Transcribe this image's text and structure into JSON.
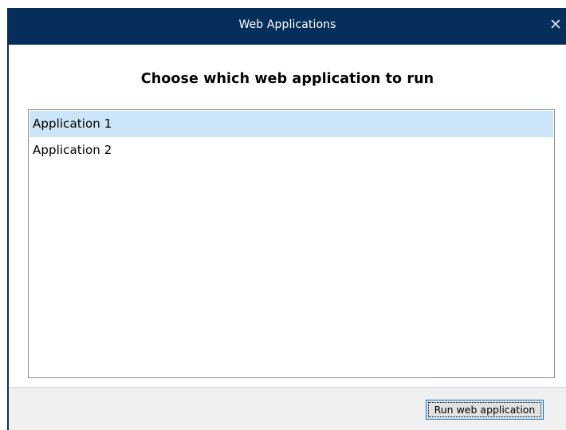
{
  "window": {
    "title": "Web Applications",
    "close_icon": "close-icon",
    "close_glyph": "✕"
  },
  "dialog": {
    "heading": "Choose which web application to run"
  },
  "list": {
    "items": [
      {
        "label": "Application 1",
        "selected": true
      },
      {
        "label": "Application 2",
        "selected": false
      }
    ]
  },
  "footer": {
    "run_label": "Run web application"
  },
  "colors": {
    "titlebar": "#062e5b",
    "selection": "#cce4f7",
    "footer": "#f0f0f0",
    "button_border": "#0078d7"
  }
}
